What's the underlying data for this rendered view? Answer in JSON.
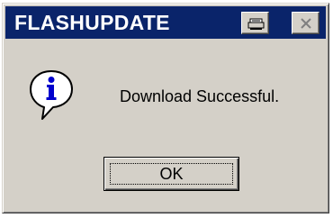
{
  "dialog": {
    "title": "FLASHUPDATE",
    "message": "Download Successful.",
    "ok_label": "OK"
  },
  "icons": {
    "titlebar_buttons": [
      "print-icon",
      "close-icon"
    ],
    "message_icon": "info-icon"
  },
  "colors": {
    "titlebar": "#0a246a",
    "dialog_face": "#d4d0c8",
    "info_blue": "#0000cc"
  }
}
